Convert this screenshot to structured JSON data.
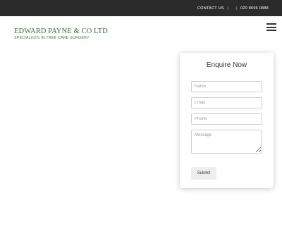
{
  "topbar": {
    "contact_label": "CONTACT US",
    "separator1": "|",
    "separator2": "|",
    "phone": "020 8696 0888"
  },
  "logo": {
    "company_name": "EDWARD PAYNE & CO LTD",
    "tagline": "SPECIALISTS IN TREE CARE SURGERY"
  },
  "enquiry_form": {
    "title": "Enquire Now",
    "name_placeholder": "Name",
    "email_placeholder": "Email",
    "phone_placeholder": "Phone",
    "message_placeholder": "Message",
    "submit_label": "Submit"
  },
  "colors": {
    "topbar_bg": "#2b2b2b",
    "brand_green": "#3a6e3a"
  },
  "icons": {
    "menu": "hamburger-menu-icon"
  }
}
